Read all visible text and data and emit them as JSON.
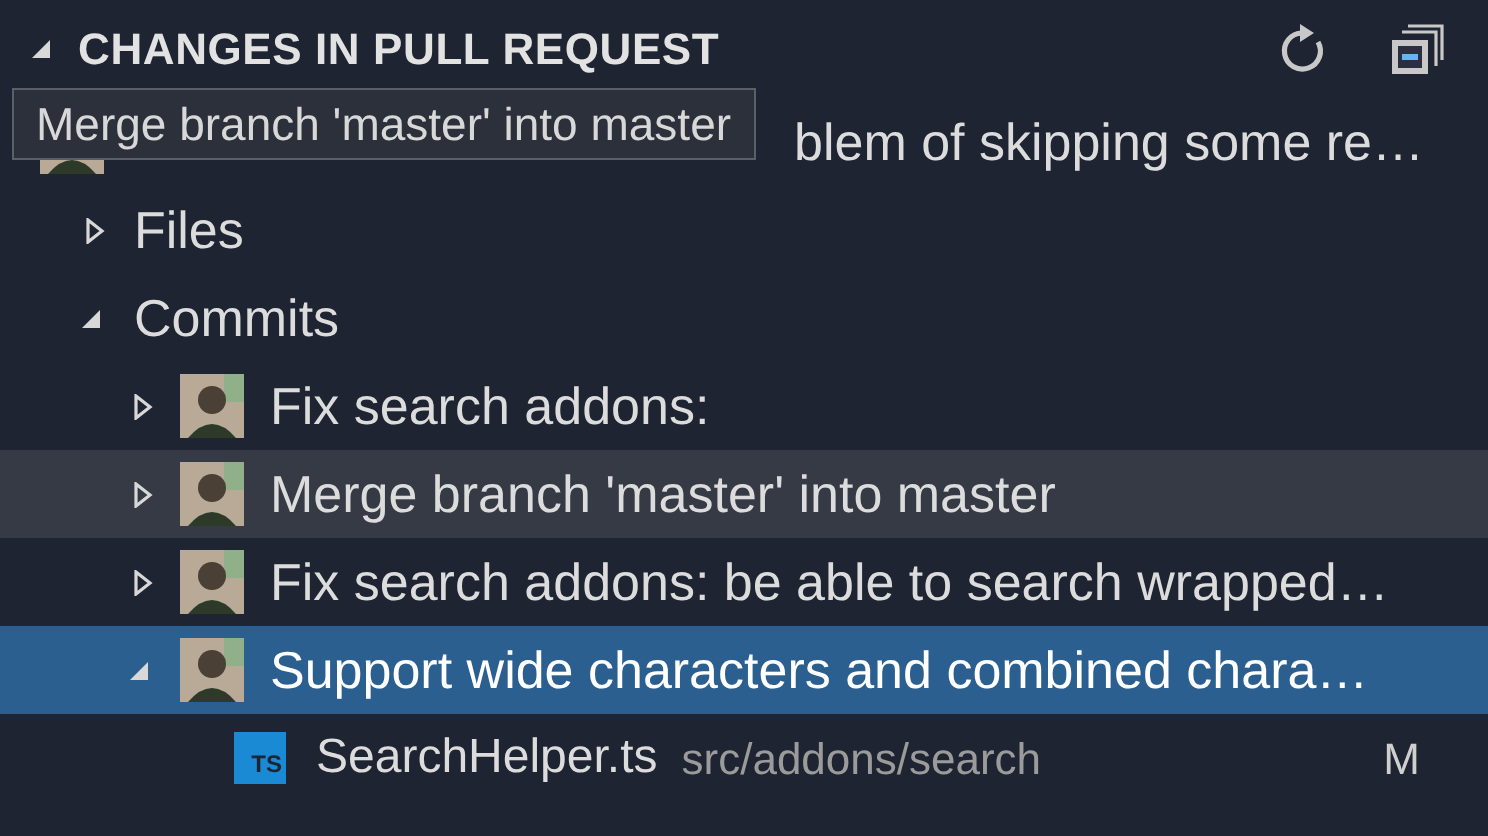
{
  "panel": {
    "title": "CHANGES IN PULL REQUEST",
    "expanded": true
  },
  "tooltip": {
    "text": "Merge branch 'master' into master"
  },
  "tree": [
    {
      "kind": "pr",
      "label": "blem of skipping some re…",
      "selected": false,
      "hovered": false,
      "children": [
        {
          "kind": "folder",
          "label": "Files",
          "expanded": false,
          "selected": false,
          "hovered": false
        },
        {
          "kind": "folder",
          "label": "Commits",
          "expanded": true,
          "selected": false,
          "hovered": false,
          "children": [
            {
              "kind": "commit",
              "label": "Fix search addons:",
              "expanded": false,
              "selected": false,
              "hovered": false
            },
            {
              "kind": "commit",
              "label": "Merge branch 'master' into master",
              "expanded": false,
              "selected": false,
              "hovered": true
            },
            {
              "kind": "commit",
              "label": "Fix search addons: be able to search wrapped…",
              "expanded": false,
              "selected": false,
              "hovered": false
            },
            {
              "kind": "commit",
              "label": "Support wide characters and combined chara…",
              "expanded": true,
              "selected": true,
              "hovered": false,
              "children": [
                {
                  "kind": "file",
                  "badge": "TS",
                  "label": "SearchHelper.ts",
                  "path": "src/addons/search",
                  "status": "M",
                  "selected": false,
                  "hovered": false
                }
              ]
            }
          ]
        }
      ]
    }
  ]
}
